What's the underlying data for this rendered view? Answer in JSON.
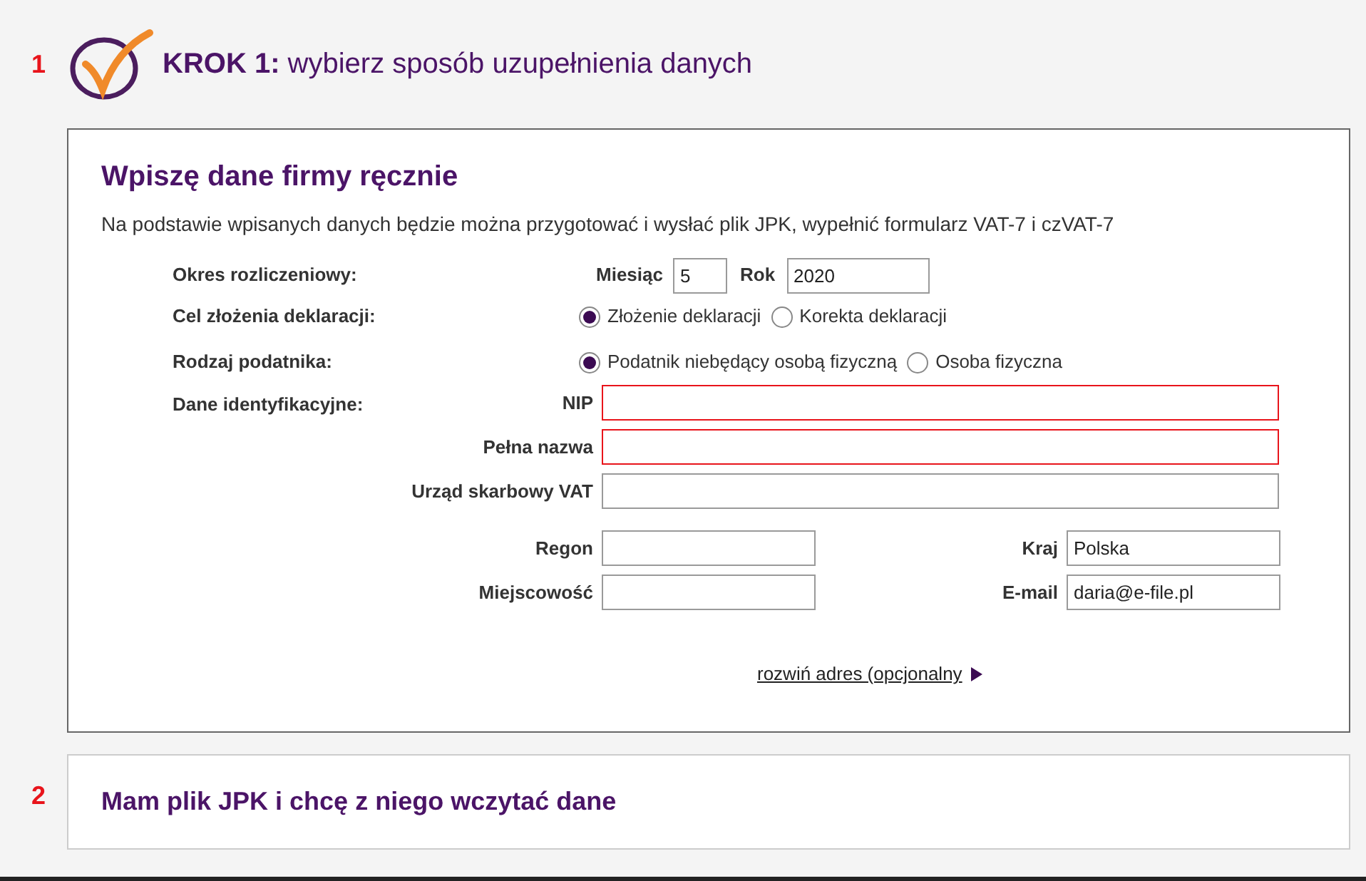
{
  "step_1": {
    "number": "1",
    "heading_bold": "KROK 1:",
    "heading": "wybierz sposób uzupełnienia danych"
  },
  "manual_card": {
    "title": "Wpiszę dane firmy ręcznie",
    "description": "Na podstawie wpisanych danych będzie można przygotować i wysłać plik JPK, wypełnić formularz VAT-7 i czVAT-7",
    "period": {
      "label": "Okres rozliczeniowy:",
      "month_label": "Miesiąc",
      "month": "5",
      "year_label": "Rok",
      "year": "2020"
    },
    "radio_groups": [
      {
        "label": "Cel złożenia deklaracji:",
        "options": [
          {
            "label": "Złożenie deklaracji",
            "selected": true
          },
          {
            "label": "Korekta deklaracji",
            "selected": false
          }
        ]
      },
      {
        "label": "Rodzaj podatnika:",
        "options": [
          {
            "label": "Podatnik niebędący osobą fizyczną",
            "selected": true
          },
          {
            "label": "Osoba fizyczna",
            "selected": false
          }
        ]
      }
    ],
    "identification": {
      "label": "Dane identyfikacyjne:",
      "fields": [
        {
          "label": "NIP",
          "error": true
        },
        {
          "label": "Pełna nazwa",
          "error": true
        },
        {
          "label": "Urząd skarbowy VAT",
          "error": false
        }
      ],
      "pair_rows": [
        {
          "left": {
            "label": "Regon"
          },
          "right": {
            "label": "Kraj",
            "value": "Polska"
          }
        },
        {
          "left": {
            "label": "Miejscowość"
          },
          "right": {
            "label": "E-mail",
            "value": "daria@e-file.pl"
          }
        }
      ]
    },
    "expand_link": "rozwiń adres (opcjonalny"
  },
  "step_2": {
    "number": "2",
    "title": "Mam plik JPK i chcę z niego wczytać dane"
  }
}
